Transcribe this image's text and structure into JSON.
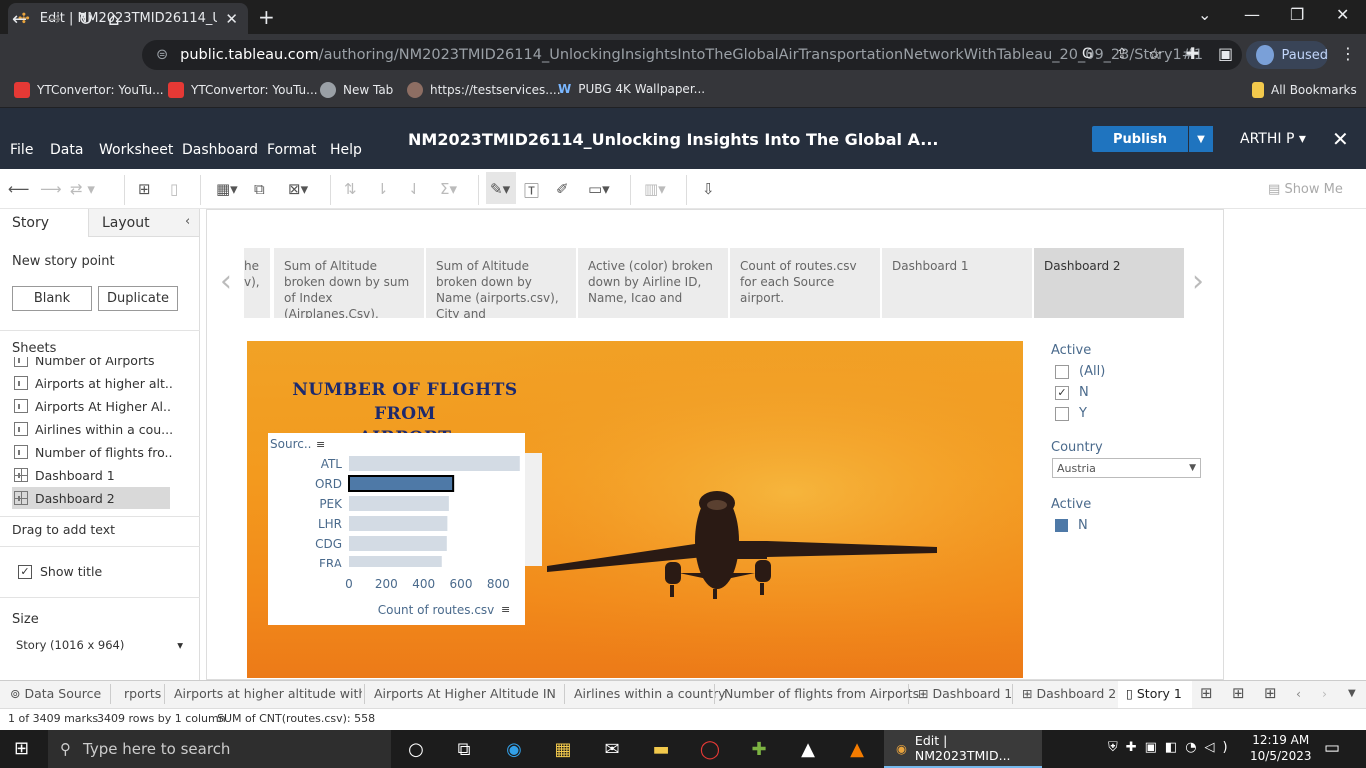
{
  "browser": {
    "tab_title": "Edit | NM2023TMID26114_Unloc",
    "url_domain": "public.tableau.com",
    "url_path": "/authoring/NM2023TMID26114_UnlockingInsightsIntoTheGlobalAirTransportationNetworkWithTableau_20_09_23/Story1#1",
    "profile_status": "Paused",
    "bookmarks": [
      "YTConvertor: YouTu...",
      "YTConvertor: YouTu...",
      "New Tab",
      "https://testservices....",
      "PUBG 4K Wallpaper..."
    ],
    "all_bookmarks": "All Bookmarks"
  },
  "tableau": {
    "menu": [
      "File",
      "Data",
      "Worksheet",
      "Dashboard",
      "Format",
      "Help"
    ],
    "workbook_title": "NM2023TMID26114_Unlocking Insights Into The Global A...",
    "publish_label": "Publish",
    "user": "ARTHI P",
    "show_me": "Show Me"
  },
  "left_pane": {
    "tabs": [
      "Story",
      "Layout"
    ],
    "new_story_point": "New story point",
    "blank_btn": "Blank",
    "duplicate_btn": "Duplicate",
    "sheets_header": "Sheets",
    "sheets": [
      "Number of Airports",
      "Airports at higher alt...",
      "Airports At Higher Al...",
      "Airlines within a cou...",
      "Number of flights fro...",
      "Dashboard 1",
      "Dashboard 2"
    ],
    "drag_text": "Drag to add text",
    "show_title": "Show title",
    "size_header": "Size",
    "size_value": "Story (1016 x 964)"
  },
  "story_points": [
    "he v),",
    "Sum of Altitude broken down by sum of Index (Airplanes.Csv), Name",
    "Sum of Altitude broken down by Name (airports.csv), City and",
    "Active (color) broken down by Airline ID, Name, Icao and",
    "Count of routes.csv for each Source airport.",
    "Dashboard 1",
    "Dashboard 2"
  ],
  "dashboard": {
    "title_line1": "NUMBER OF FLIGHTS FROM",
    "title_line2": "AIRPORT"
  },
  "chart_data": {
    "type": "bar",
    "orientation": "horizontal",
    "ylabel": "Sourc..",
    "xlabel": "Count of routes.csv",
    "categories": [
      "ATL",
      "ORD",
      "PEK",
      "LHR",
      "CDG",
      "FRA"
    ],
    "values": [
      915,
      558,
      535,
      527,
      524,
      497
    ],
    "x_ticks": [
      "0",
      "200",
      "400",
      "600",
      "800"
    ],
    "xlim": [
      0,
      900
    ],
    "selected_category": "ORD",
    "colors": {
      "bar": "#d3dbe4",
      "selected": "#4e79a7"
    }
  },
  "filters": {
    "active1_title": "Active",
    "active1_options": [
      {
        "label": "(All)",
        "checked": false
      },
      {
        "label": "N",
        "checked": true
      },
      {
        "label": "Y",
        "checked": false
      }
    ],
    "country_title": "Country",
    "country_value": "Austria",
    "active2_title": "Active",
    "active2_legend": "N",
    "legend_color": "#4e79a7"
  },
  "sheet_tabs": [
    "Data Source",
    "rports",
    "Airports at higher altitude withi...",
    "Airports At Higher Altitude IN ...",
    "Airlines within a country",
    "Number of flights from Airports",
    "Dashboard 1",
    "Dashboard 2",
    "Story 1"
  ],
  "status_bar": {
    "marks": "1 of 3409 marks",
    "rows": "3409 rows by 1 column",
    "sum": "SUM of CNT(routes.csv): 558"
  },
  "taskbar": {
    "search_placeholder": "Type here to search",
    "active_app": "Edit | NM2023TMID...",
    "time": "12:19 AM",
    "date": "10/5/2023"
  }
}
